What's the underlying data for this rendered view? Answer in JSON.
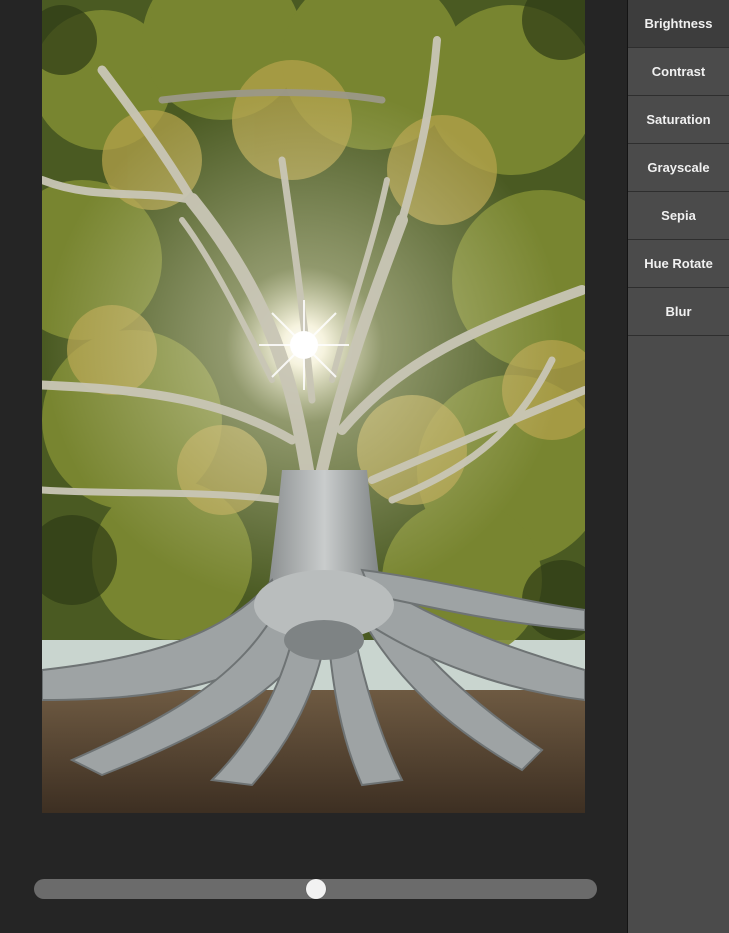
{
  "filters": [
    {
      "label": "Brightness",
      "active": true
    },
    {
      "label": "Contrast",
      "active": false
    },
    {
      "label": "Saturation",
      "active": false
    },
    {
      "label": "Grayscale",
      "active": false
    },
    {
      "label": "Sepia",
      "active": false
    },
    {
      "label": "Hue Rotate",
      "active": false
    },
    {
      "label": "Blur",
      "active": false
    }
  ],
  "slider": {
    "value_fraction": 0.5
  },
  "colors": {
    "background": "#252525",
    "panel": "#4b4b4b",
    "panel_active": "#3d3d3d",
    "slider_track": "#6b6b6b",
    "slider_thumb": "#f2f2f2"
  }
}
